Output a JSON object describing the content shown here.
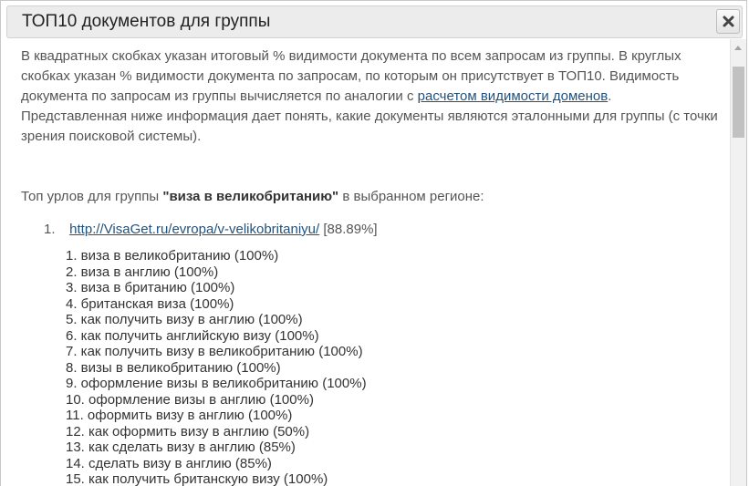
{
  "dialog": {
    "title": "ТОП10 документов для группы",
    "close_icon": "close-x-icon"
  },
  "intro": {
    "text_before_link": "В квадратных скобках указан итоговый % видимости документа по всем запросам из группы. В круглых скобках указан % видимости документа по запросам, по которым он присутствует в ТОП10. Видимость документа по запросам из группы вычисляется по аналогии с ",
    "link_text": "расчетом видимости доменов",
    "text_after_link": ".",
    "second_paragraph": "Представленная ниже информация дает понять, какие документы являются эталонными для группы (с точки зрения поисковой системы)."
  },
  "heading": {
    "prefix": "Топ урлов для группы ",
    "group_name": "\"виза в великобританию\"",
    "suffix": " в выбранном регионе:"
  },
  "results": [
    {
      "number": "1.",
      "url": "http://VisaGet.ru/evropa/v-velikobritaniyu/",
      "visibility": "[88.89%]",
      "queries": [
        "1. виза в великобританию (100%)",
        "2. виза в англию (100%)",
        "3. виза в британию (100%)",
        "4. британская виза (100%)",
        "5. как получить визу в англию (100%)",
        "6. как получить английскую визу (100%)",
        "7. как получить визу в великобританию (100%)",
        "8. визы в великобританию (100%)",
        "9. оформление визы в великобританию (100%)",
        "10. оформление визы в англию (100%)",
        "11. оформить визу в англию (100%)",
        "12. как оформить визу в англию (50%)",
        "13. как сделать визу в англию (85%)",
        "14. сделать визу в англию (85%)",
        "15. как получить британскую визу (100%)"
      ]
    }
  ]
}
